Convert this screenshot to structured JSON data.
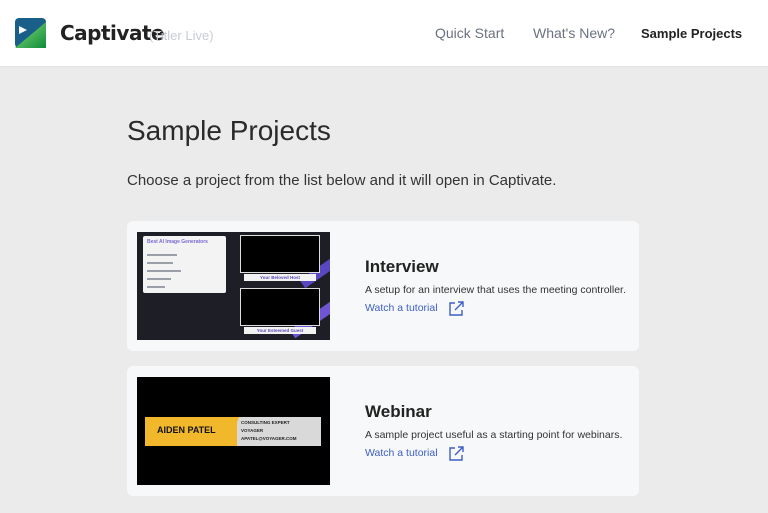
{
  "header": {
    "app_name": "Captivate",
    "app_subtitle": "(Titler Live)",
    "nav": [
      {
        "label": "Quick Start"
      },
      {
        "label": "What's New?"
      },
      {
        "label": "Sample Projects"
      }
    ],
    "active_nav": "Sample Projects"
  },
  "main": {
    "title": "Sample Projects",
    "intro": "Choose a project from the list below and it will open in Captivate.",
    "projects": [
      {
        "name": "Interview",
        "description": "A setup for an interview that uses the meeting controller.",
        "link": "Watch a tutorial",
        "thumb": {
          "panel_title": "Best AI Image Generators",
          "caption_1": "Your Beloved Host",
          "caption_2": "Your Esteemed Guest"
        }
      },
      {
        "name": "Webinar",
        "description": "A sample project useful as a starting point for webinars.",
        "link": "Watch a tutorial",
        "thumb": {
          "name": "AIDEN PATEL",
          "info_1": "CONSULTING EXPERT",
          "info_2": "VOYAGER",
          "info_3": "APATEL@VOYAGER.COM"
        }
      }
    ]
  },
  "colors": {
    "background": "#ebebeb",
    "card": "#f7f8f9",
    "link": "#3d5fc4",
    "logo_green": "#2bb14a",
    "accent_yellow": "#f2b82b",
    "accent_purple": "#6f55d6"
  }
}
